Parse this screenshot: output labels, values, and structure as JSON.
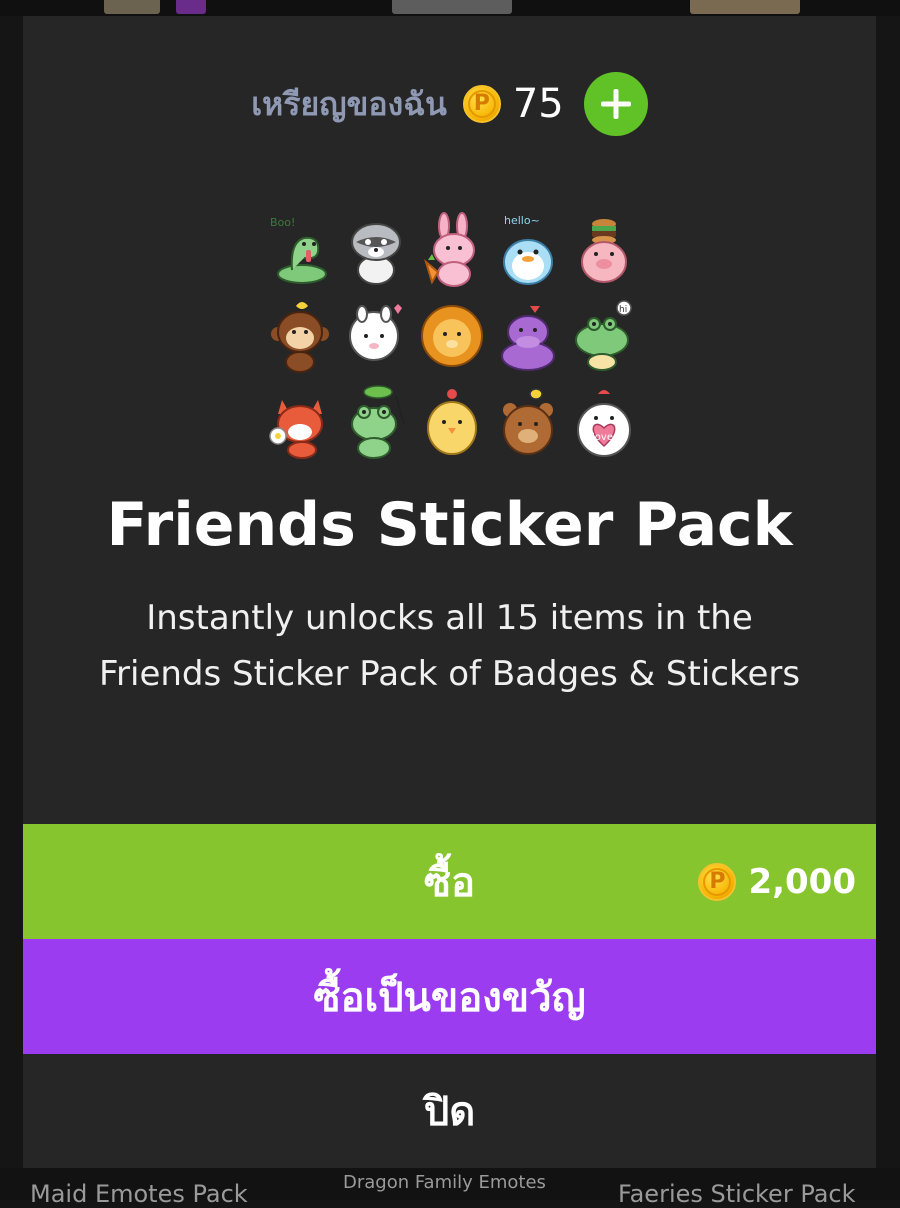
{
  "wallet": {
    "label": "เหรียญของฉัน",
    "coin_symbol": "P",
    "balance": "75",
    "add_label": "+",
    "icons": [
      "coin-icon",
      "plus-icon"
    ]
  },
  "pack": {
    "title": "Friends Sticker Pack",
    "description": "Instantly unlocks all 15 items in the Friends Sticker Pack of Badges & Stickers",
    "sticker_count": 15,
    "stickers": [
      {
        "name": "snake",
        "caption": "Boo!"
      },
      {
        "name": "raccoon"
      },
      {
        "name": "bunny"
      },
      {
        "name": "penguin",
        "caption": "hello~"
      },
      {
        "name": "pig"
      },
      {
        "name": "monkey"
      },
      {
        "name": "alpaca"
      },
      {
        "name": "lion"
      },
      {
        "name": "hippo"
      },
      {
        "name": "crocodile",
        "caption": "hi"
      },
      {
        "name": "fox"
      },
      {
        "name": "frog"
      },
      {
        "name": "chick"
      },
      {
        "name": "bear"
      },
      {
        "name": "chicken",
        "caption": "love"
      }
    ]
  },
  "actions": {
    "buy_label": "ซื้อ",
    "buy_price": "2,000",
    "gift_label": "ซื้อเป็นของขวัญ",
    "close_label": "ปิด"
  },
  "background": {
    "labels": [
      "Maid Emotes Pack",
      "Dragon Family Emotes",
      "Faeries Sticker Pack"
    ]
  },
  "colors": {
    "modal_bg": "#262626",
    "buy_green": "#87c52e",
    "gift_purple": "#9b3cf0",
    "add_green": "#60c226",
    "coin_gold": "#f7b400",
    "wallet_label": "#8f99b4"
  }
}
